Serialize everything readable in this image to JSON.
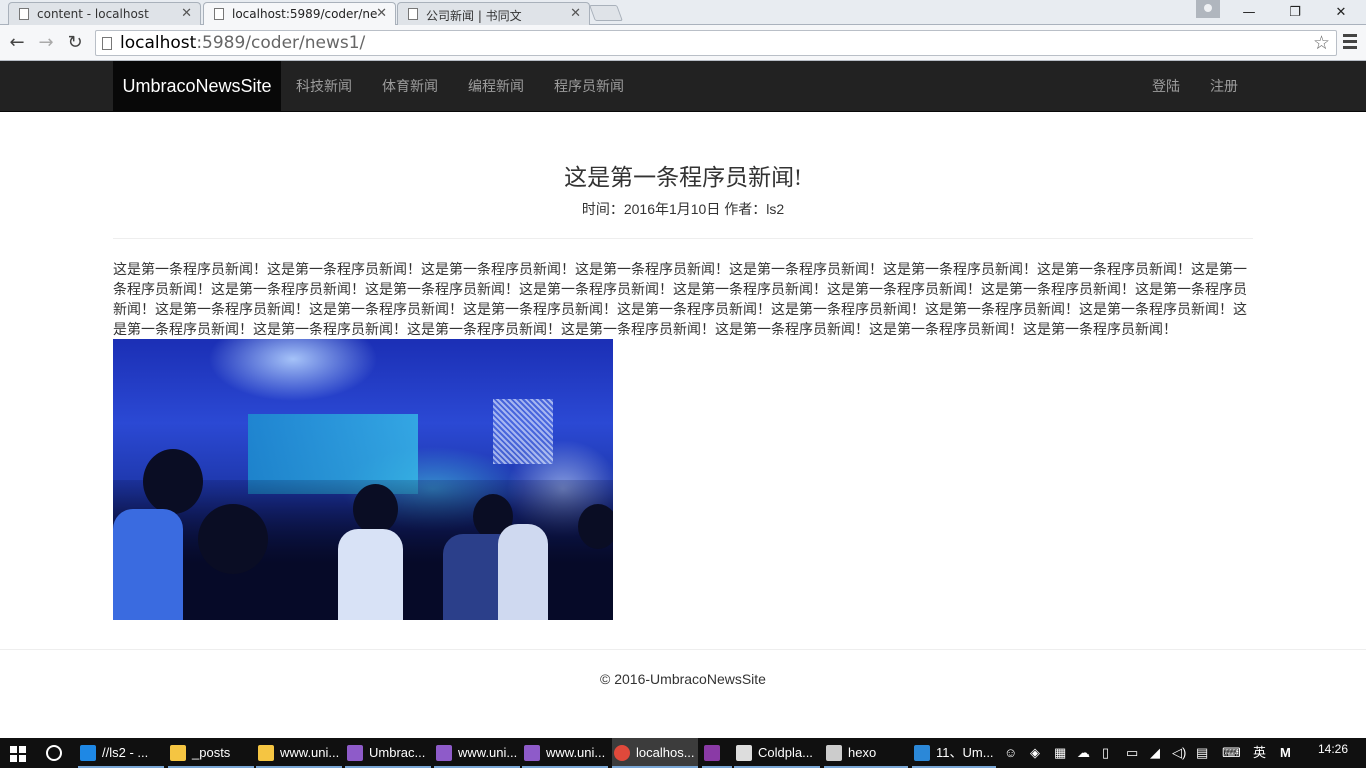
{
  "browser": {
    "tabs": [
      {
        "label": "content - localhost",
        "active": false
      },
      {
        "label": "localhost:5989/coder/ne",
        "active": true
      },
      {
        "label": "公司新闻 | 书同文",
        "active": false
      }
    ],
    "url_host": "localhost",
    "url_rest": ":5989/coder/news1/",
    "icons": {
      "back": "back-arrow-icon",
      "forward": "forward-arrow-icon",
      "reload": "reload-icon",
      "bookmark": "star-icon",
      "menu": "hamburger-menu-icon"
    }
  },
  "window_controls": {
    "minimize": "—",
    "restore": "❐",
    "close": "✕"
  },
  "site": {
    "brand": "UmbracoNewsSite",
    "nav_left": [
      "科技新闻",
      "体育新闻",
      "编程新闻",
      "程序员新闻"
    ],
    "nav_right": [
      "登陆",
      "注册"
    ]
  },
  "article": {
    "title": "这是第一条程序员新闻!",
    "meta": "时间：2016年1月10日 作者：ls2",
    "body": "这是第一条程序员新闻！这是第一条程序员新闻！这是第一条程序员新闻！这是第一条程序员新闻！这是第一条程序员新闻！这是第一条程序员新闻！这是第一条程序员新闻！这是第一条程序员新闻！这是第一条程序员新闻！这是第一条程序员新闻！这是第一条程序员新闻！这是第一条程序员新闻！这是第一条程序员新闻！这是第一条程序员新闻！这是第一条程序员新闻！这是第一条程序员新闻！这是第一条程序员新闻！这是第一条程序员新闻！这是第一条程序员新闻！这是第一条程序员新闻！这是第一条程序员新闻！这是第一条程序员新闻！这是第一条程序员新闻！这是第一条程序员新闻！这是第一条程序员新闻！这是第一条程序员新闻！这是第一条程序员新闻！这是第一条程序员新闻！这是第一条程序员新闻！"
  },
  "footer": {
    "text": "© 2016-UmbracoNewsSite"
  },
  "taskbar": {
    "tasks": [
      {
        "label": "//ls2 - ...",
        "icon": "edge-icon",
        "color": "#1e88e5"
      },
      {
        "label": "_posts",
        "icon": "folder-icon",
        "color": "#f5c542"
      },
      {
        "label": "www.uni...",
        "icon": "folder-icon",
        "color": "#f5c542"
      },
      {
        "label": "Umbrac...",
        "icon": "visual-studio-icon",
        "color": "#8e5bc9"
      },
      {
        "label": "www.uni...",
        "icon": "visual-studio-icon",
        "color": "#8e5bc9"
      },
      {
        "label": "www.uni...",
        "icon": "visual-studio-icon",
        "color": "#8e5bc9"
      },
      {
        "label": "localhos...",
        "icon": "chrome-icon",
        "color": "#e0493b"
      },
      {
        "label": "",
        "icon": "onenote-icon",
        "color": "#8a3aa6"
      },
      {
        "label": "Coldpla...",
        "icon": "music-icon",
        "color": "#dddddd"
      },
      {
        "label": "hexo",
        "icon": "terminal-icon",
        "color": "#cccccc"
      },
      {
        "label": "11、Um...",
        "icon": "vscode-icon",
        "color": "#2b88d8"
      }
    ],
    "ime": "英",
    "clock": "14:26"
  }
}
